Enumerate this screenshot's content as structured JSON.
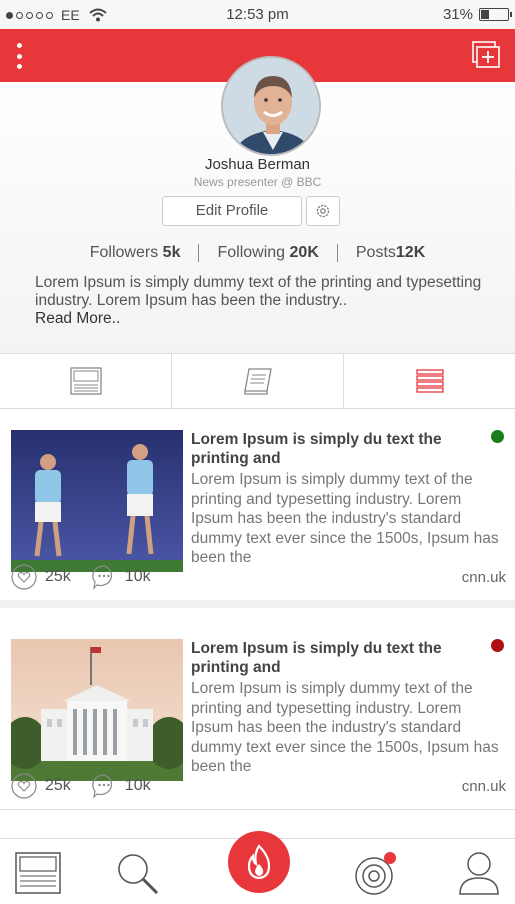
{
  "status_bar": {
    "carrier": "EE",
    "time": "12:53 pm",
    "battery": "31%"
  },
  "profile": {
    "name": "Joshua Berman",
    "role": "News presenter @ BBC",
    "edit_label": "Edit Profile",
    "followers_label": "Followers",
    "followers_value": "5k",
    "following_label": "Following",
    "following_value": "20K",
    "posts_label": "Posts",
    "posts_value": "12K",
    "bio": "Lorem Ipsum is simply dummy text of the printing and typesetting industry. Lorem Ipsum has been the industry..",
    "read_more": "Read More.."
  },
  "feed": [
    {
      "title": "Lorem Ipsum is simply du text  the printing and",
      "body": "Lorem Ipsum is simply dummy text of the printing and typesetting industry. Lorem Ipsum has been the industry's standard dummy text ever since the 1500s, Ipsum has been the",
      "likes": "25k",
      "comments": "10k",
      "source": "cnn.uk",
      "status_color": "#1a7f1a"
    },
    {
      "title": "Lorem Ipsum is simply du text  the printing and",
      "body": "Lorem Ipsum is simply dummy text of the printing and typesetting industry. Lorem Ipsum has been the industry's standard dummy text ever since the 1500s, Ipsum has been the",
      "likes": "25k",
      "comments": "10k",
      "source": "cnn.uk",
      "status_color": "#b01010"
    }
  ],
  "colors": {
    "accent": "#e8373b"
  },
  "icons": {
    "topbar": [
      "menu-icon",
      "add-post-icon"
    ],
    "tabs": [
      "newspaper-icon",
      "magazine-icon",
      "list-icon"
    ],
    "nav": [
      "newspaper-icon",
      "search-icon",
      "trending-icon",
      "target-icon",
      "user-icon"
    ]
  }
}
